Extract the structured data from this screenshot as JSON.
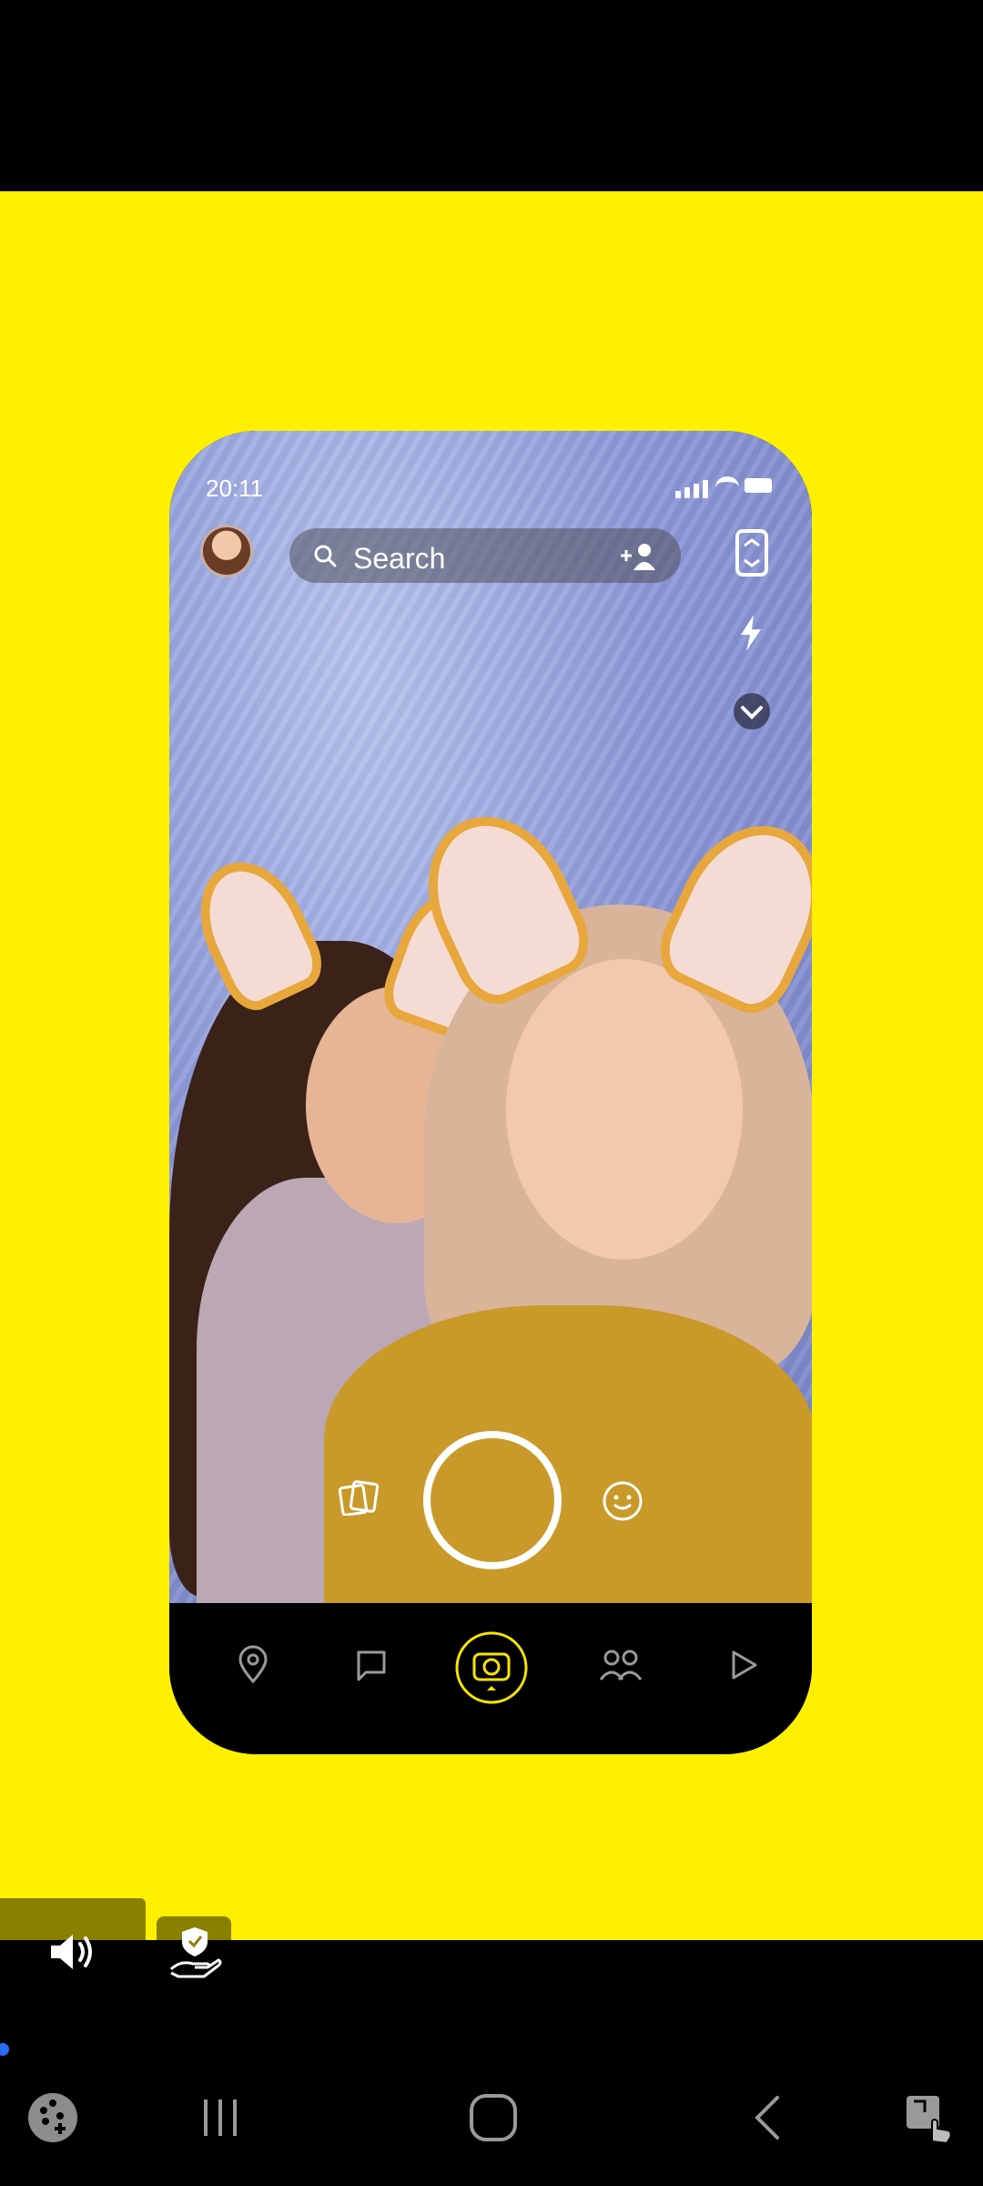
{
  "status": {
    "time": "20:11"
  },
  "search": {
    "label": "Search"
  },
  "colors": {
    "brand_yellow": "#FFF000",
    "nav_active": "#F7E400"
  },
  "nav": {
    "items": [
      "map-pin-icon",
      "chat-icon",
      "camera-icon",
      "friends-icon",
      "play-icon"
    ],
    "active": "camera-icon"
  },
  "system_nav": [
    "game-launcher-icon",
    "recents-icon",
    "home-icon",
    "back-icon",
    "screenshot-assist-icon"
  ]
}
